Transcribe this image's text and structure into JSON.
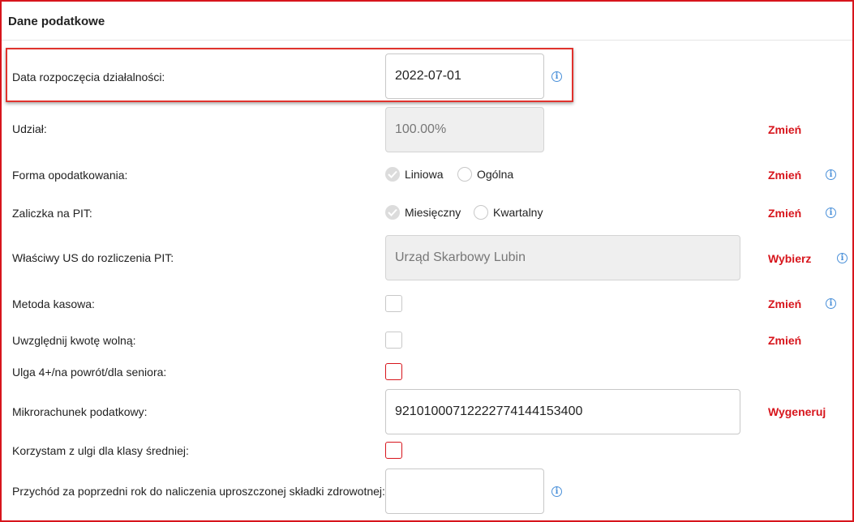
{
  "header": {
    "title": "Dane podatkowe"
  },
  "rows": {
    "start_date": {
      "label": "Data rozpoczęcia działalności:",
      "value": "2022-07-01"
    },
    "share": {
      "label": "Udział:",
      "value": "100.00%",
      "action": "Zmień"
    },
    "tax_form": {
      "label": "Forma opodatkowania:",
      "options": [
        "Liniowa",
        "Ogólna"
      ],
      "selected": "Liniowa",
      "action": "Zmień"
    },
    "pit_advance": {
      "label": "Zaliczka na PIT:",
      "options": [
        "Miesięczny",
        "Kwartalny"
      ],
      "selected": "Miesięczny",
      "action": "Zmień"
    },
    "tax_office": {
      "label": "Właściwy US do rozliczenia PIT:",
      "value": "Urząd Skarbowy Lubin",
      "action": "Wybierz"
    },
    "cash_method": {
      "label": "Metoda kasowa:",
      "checked": false,
      "action": "Zmień"
    },
    "tax_free": {
      "label": "Uwzględnij kwotę wolną:",
      "checked": false,
      "action": "Zmień"
    },
    "relief_4plus": {
      "label": "Ulga 4+/na powrót/dla seniora:",
      "checked": false
    },
    "micro_account": {
      "label": "Mikrorachunek podatkowy:",
      "value": "92101000712222774144153400",
      "action": "Wygeneruj"
    },
    "middle_class": {
      "label": "Korzystam z ulgi dla klasy średniej:",
      "checked": false
    },
    "prev_income": {
      "label": "Przychód za poprzedni rok do naliczenia uproszczonej składki zdrowotnej:",
      "value": ""
    }
  },
  "colors": {
    "accent": "#d7151c",
    "info": "#4a90d9",
    "disabled_bg": "#efefef"
  }
}
